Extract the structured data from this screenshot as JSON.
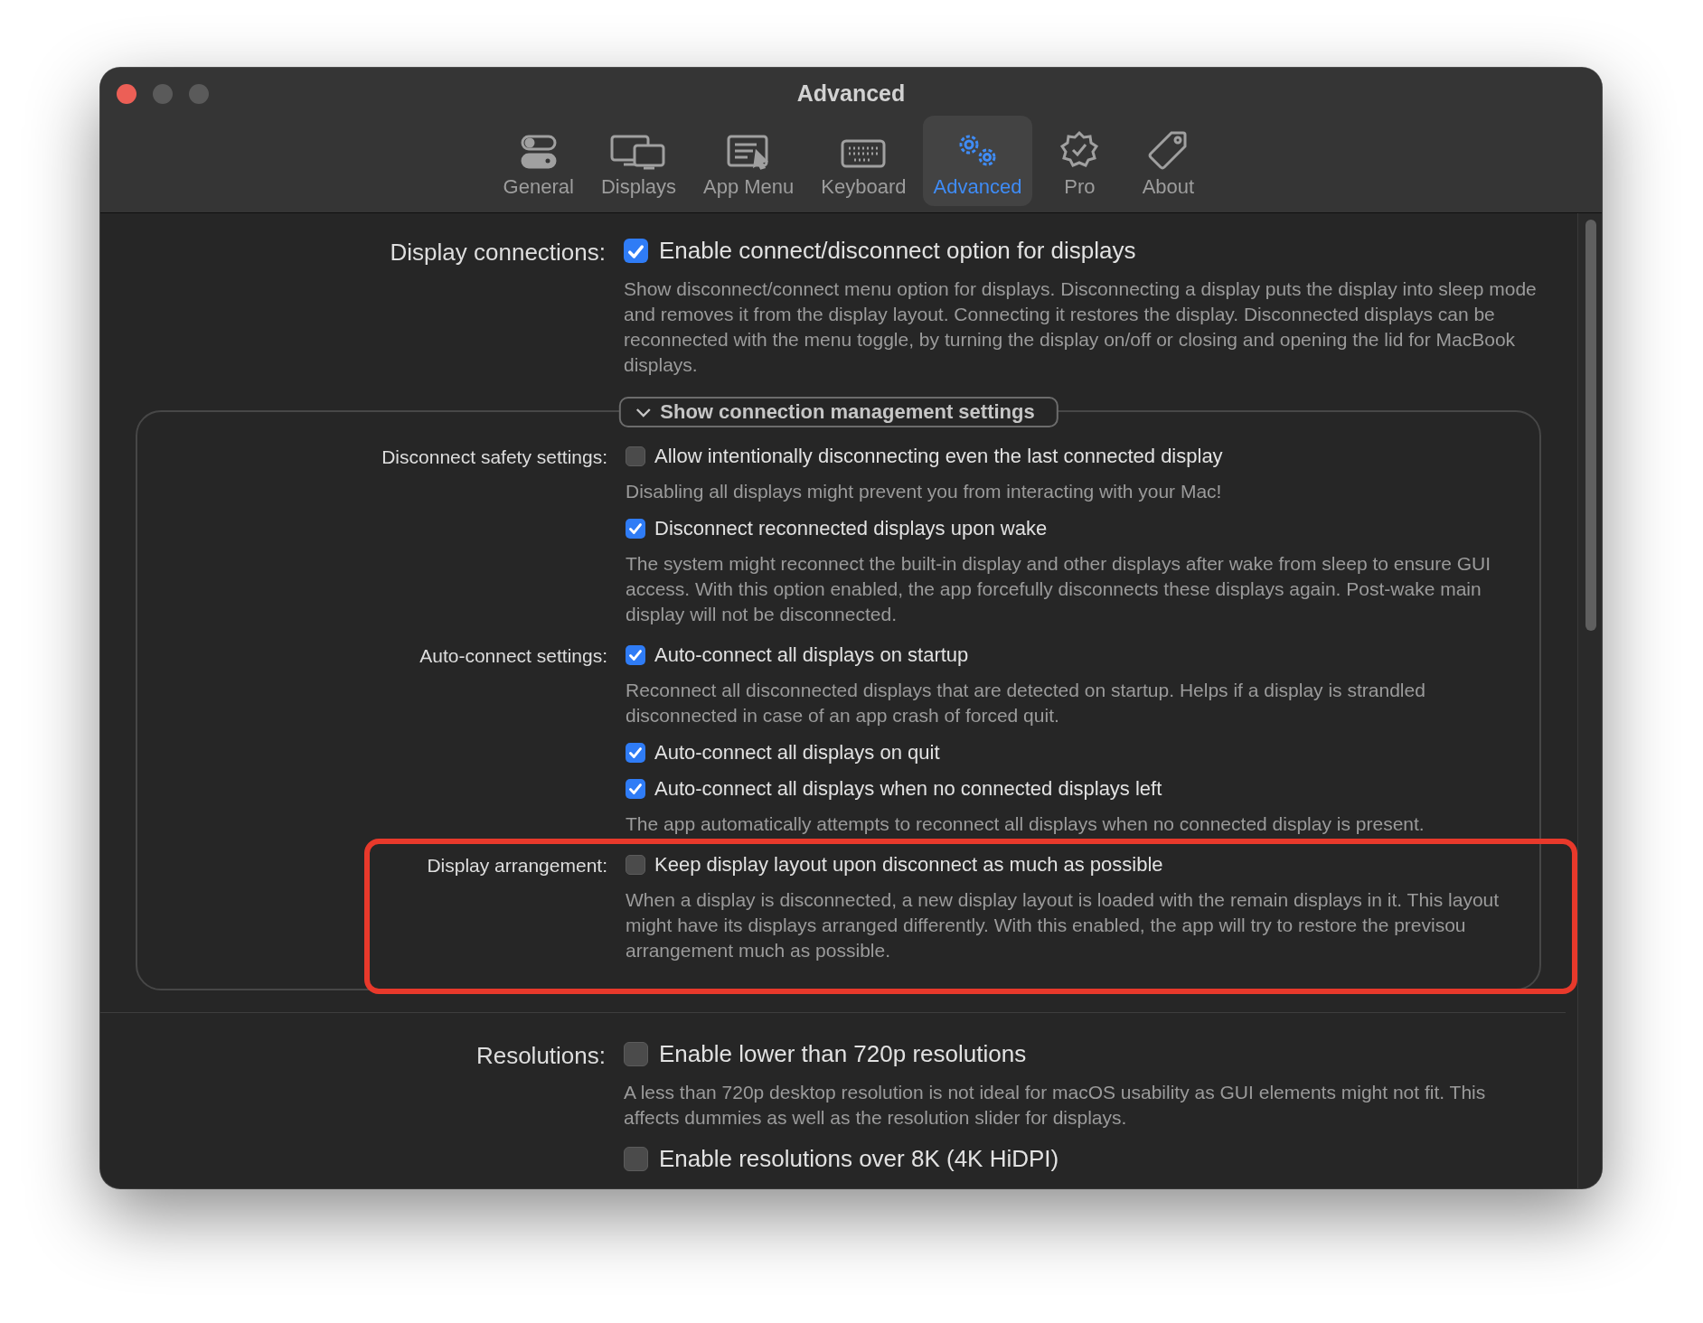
{
  "window": {
    "title": "Advanced"
  },
  "tabs": [
    {
      "label": "General",
      "selected": false
    },
    {
      "label": "Displays",
      "selected": false
    },
    {
      "label": "App Menu",
      "selected": false
    },
    {
      "label": "Keyboard",
      "selected": false
    },
    {
      "label": "Advanced",
      "selected": true
    },
    {
      "label": "Pro",
      "selected": false
    },
    {
      "label": "About",
      "selected": false
    }
  ],
  "sections": [
    {
      "kind": "main",
      "label": "Display connections:",
      "options": [
        {
          "label": "Enable connect/disconnect option for displays",
          "checked": true,
          "description": "Show disconnect/connect menu option for displays. Disconnecting a display puts the display into sleep mode and removes it from the display layout. Connecting it restores the display. Disconnected displays can be reconnected with the menu toggle, by turning the display on/off or closing and opening the lid for MacBook displays."
        }
      ]
    },
    {
      "kind": "group",
      "disclosure": {
        "label": "Show connection management settings",
        "expanded": true
      },
      "rows": [
        {
          "label": "Disconnect safety settings:",
          "highlighted": false,
          "options": [
            {
              "label": "Allow intentionally disconnecting even the last connected display",
              "checked": false,
              "description": "Disabling all displays might prevent you from interacting with your Mac!"
            },
            {
              "label": "Disconnect reconnected displays upon wake",
              "checked": true,
              "description": "The system might reconnect the built-in display and other displays after wake from sleep to ensure GUI access. With this option enabled, the app forcefully disconnects these displays again. Post-wake main display will not be disconnected."
            }
          ]
        },
        {
          "label": "Auto-connect settings:",
          "highlighted": false,
          "options": [
            {
              "label": "Auto-connect all displays on startup",
              "checked": true,
              "description": "Reconnect all disconnected displays that are detected on startup. Helps if a display is strandled disconnected in case of an app crash of forced quit."
            },
            {
              "label": "Auto-connect all displays on quit",
              "checked": true
            },
            {
              "label": "Auto-connect all displays when no connected displays left",
              "checked": true,
              "description": "The app automatically attempts to reconnect all displays when no connected display is present."
            }
          ]
        },
        {
          "label": "Display arrangement:",
          "highlighted": true,
          "options": [
            {
              "label": "Keep display layout upon disconnect as much as possible",
              "checked": false,
              "description": "When a display is disconnected, a new display layout is loaded with the remain displays in it. This layout might have its displays arranged differently. With this enabled, the app will try to restore the previsou arrangement much as possible."
            }
          ]
        }
      ]
    },
    {
      "kind": "main",
      "label": "Resolutions:",
      "options": [
        {
          "label": "Enable lower than 720p resolutions",
          "checked": false,
          "description": "A less than 720p desktop resolution is not ideal for macOS usability as GUI elements might not fit. This affects dummies as well as the resolution slider for displays."
        },
        {
          "label": "Enable resolutions over 8K (4K HiDPI)",
          "checked": false
        }
      ]
    }
  ]
}
